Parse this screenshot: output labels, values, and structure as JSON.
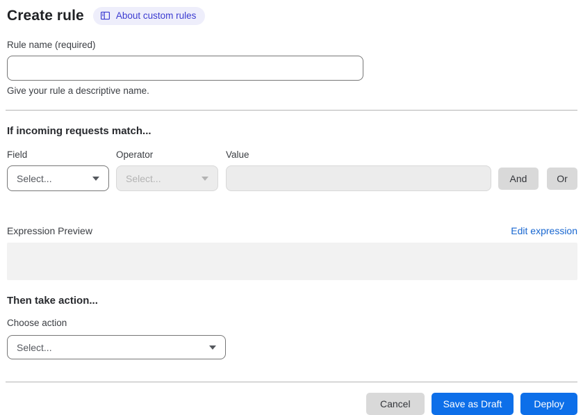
{
  "header": {
    "title": "Create rule",
    "about_link": "About custom rules"
  },
  "rule_name": {
    "label": "Rule name (required)",
    "value": "",
    "helper": "Give your rule a descriptive name."
  },
  "match_section": {
    "heading": "If incoming requests match...",
    "field": {
      "label": "Field",
      "selected": "Select..."
    },
    "operator": {
      "label": "Operator",
      "selected": "Select...",
      "disabled": true
    },
    "value": {
      "label": "Value",
      "value": "",
      "disabled": true
    },
    "and_button": "And",
    "or_button": "Or"
  },
  "expression": {
    "label": "Expression Preview",
    "edit_link": "Edit expression",
    "content": ""
  },
  "action_section": {
    "heading": "Then take action...",
    "choose_label": "Choose action",
    "selected": "Select..."
  },
  "footer": {
    "cancel": "Cancel",
    "save_draft": "Save as Draft",
    "deploy": "Deploy"
  },
  "icons": {
    "about": "book-icon",
    "selects": "chevron-down-icon"
  },
  "colors": {
    "primary_button": "#0d6fe9",
    "link_blue": "#1766d0",
    "badge_bg": "#eeeefb",
    "badge_text": "#3b3bd1",
    "gray_button": "#d9d9d9",
    "disabled_bg": "#ececec",
    "preview_bg": "#f2f2f2",
    "divider": "#b4b4b4"
  }
}
